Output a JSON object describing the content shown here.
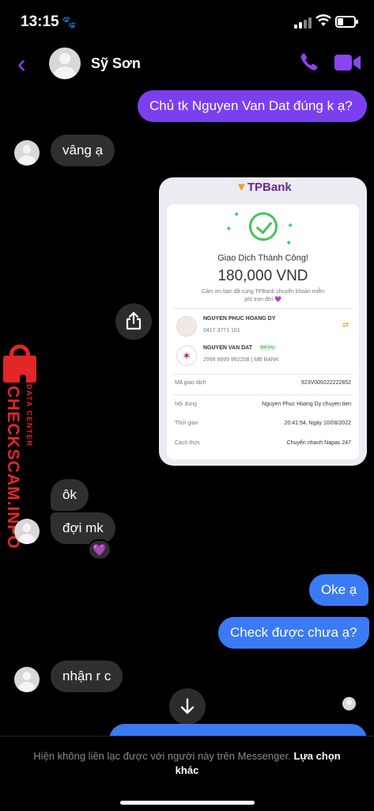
{
  "status_bar": {
    "time": "13:15",
    "paw_icon": "🐾"
  },
  "header": {
    "back_icon": "‹",
    "contact_name": "Sỹ Sơn",
    "icons": [
      "phone-icon",
      "video-camera-icon"
    ],
    "accent": "#8b45f0"
  },
  "messages": {
    "out1": "Chủ tk Nguyen Van Dat đúng k ạ?",
    "in1": "vâng ạ",
    "in2": "ôk",
    "in3": "đợi mk",
    "reaction": "💜",
    "out2": "Oke ạ",
    "out3": "Check được chưa ạ?",
    "in4": "nhận r c"
  },
  "receipt": {
    "logo_mark": "▼",
    "logo": "TPBank",
    "status": "Giao Dịch Thành Công!",
    "amount": "180,000 VND",
    "thanks": "Cảm ơn bạn đã cùng TPBank chuyển khoản miễn phí trọn đời",
    "thanks_heart": "💜",
    "sender": {
      "name": "NGUYEN PHUC HOANG DY",
      "account": "0417 3771 101"
    },
    "receiver": {
      "name": "NGUYEN VAN DAT",
      "badge": "Đã lưu",
      "account": "2999 9999 992208 | MB BANK"
    },
    "rows": [
      {
        "label": "Mã giao dịch",
        "value": "923V009222222852"
      },
      {
        "label": "Nội dung",
        "value": "Nguyen Phuc Hoang Dy chuyen tien"
      },
      {
        "label": "Thời gian",
        "value": "20:41:54, Ngày 10/08/2022"
      },
      {
        "label": "Cách thức",
        "value": "Chuyển nhanh Napas 247"
      }
    ]
  },
  "watermark": {
    "title": "CHECKSCAM.INFO",
    "subtitle": "DATA CENTER"
  },
  "footer": {
    "note": "Hiện không liên lạc được với người này trên Messenger.",
    "link": "Lựa chọn khác"
  },
  "colors": {
    "purple_bubble": "#7c3ff0",
    "blue_bubble": "#3b7af5",
    "incoming_bubble": "#2f2f2f",
    "watermark": "#e32626"
  }
}
